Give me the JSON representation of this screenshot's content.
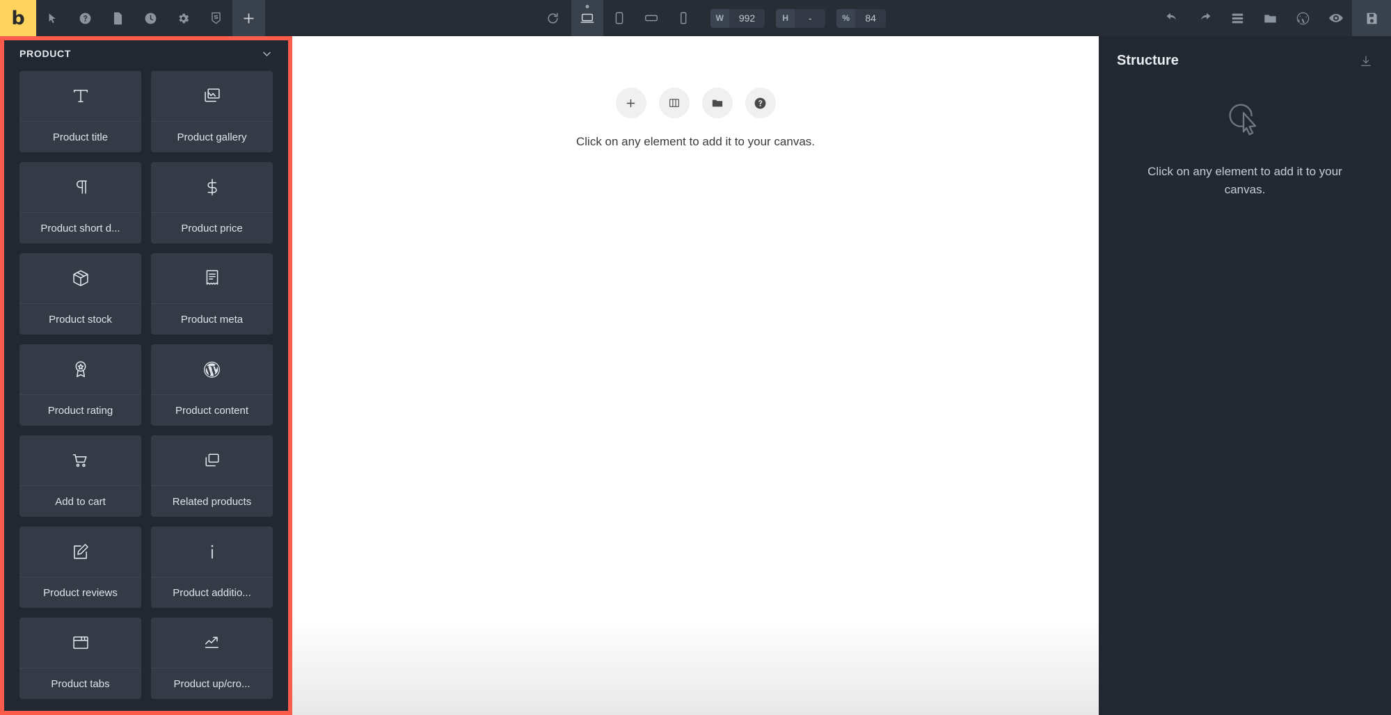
{
  "toolbar": {
    "logo_text": "b",
    "left_icons": [
      {
        "name": "cursor-icon",
        "label": "Select"
      },
      {
        "name": "help-icon",
        "label": "Help"
      },
      {
        "name": "page-icon",
        "label": "Pages"
      },
      {
        "name": "history-icon",
        "label": "History"
      },
      {
        "name": "gear-icon",
        "label": "Settings"
      },
      {
        "name": "css-icon",
        "label": "CSS"
      }
    ],
    "add_label": "+",
    "reload_label": "Reload",
    "devices": [
      {
        "name": "desktop-icon",
        "label": "Desktop",
        "active": true
      },
      {
        "name": "tablet-portrait-icon",
        "label": "Tablet",
        "active": false
      },
      {
        "name": "tablet-landscape-icon",
        "label": "Tablet landscape",
        "active": false
      },
      {
        "name": "mobile-icon",
        "label": "Mobile",
        "active": false
      }
    ],
    "fields": [
      {
        "label": "W",
        "value": "992"
      },
      {
        "label": "H",
        "value": "-"
      },
      {
        "label": "%",
        "value": "84"
      }
    ],
    "right_icons": [
      {
        "name": "undo-icon",
        "label": "Undo"
      },
      {
        "name": "redo-icon",
        "label": "Redo"
      },
      {
        "name": "layers-icon",
        "label": "Layers"
      },
      {
        "name": "folder-icon",
        "label": "Folder"
      },
      {
        "name": "wordpress-icon",
        "label": "WordPress"
      },
      {
        "name": "eye-icon",
        "label": "Preview"
      }
    ],
    "save_label": "Save"
  },
  "sidebar": {
    "panel_title": "PRODUCT",
    "collapse_icon": "chevron-down-icon",
    "highlight_color": "#fb5c4c",
    "tiles": [
      {
        "label": "Product title",
        "icon": "text-title-icon"
      },
      {
        "label": "Product gallery",
        "icon": "image-gallery-icon"
      },
      {
        "label": "Product short d...",
        "icon": "paragraph-icon"
      },
      {
        "label": "Product price",
        "icon": "dollar-icon"
      },
      {
        "label": "Product stock",
        "icon": "box-icon"
      },
      {
        "label": "Product meta",
        "icon": "receipt-icon"
      },
      {
        "label": "Product rating",
        "icon": "award-icon"
      },
      {
        "label": "Product content",
        "icon": "wordpress-icon"
      },
      {
        "label": "Add to cart",
        "icon": "cart-icon"
      },
      {
        "label": "Related products",
        "icon": "copy-icon"
      },
      {
        "label": "Product reviews",
        "icon": "edit-note-icon"
      },
      {
        "label": "Product additio...",
        "icon": "info-icon"
      },
      {
        "label": "Product tabs",
        "icon": "folder-tabs-icon"
      },
      {
        "label": "Product up/cro...",
        "icon": "trend-up-icon"
      }
    ]
  },
  "canvas": {
    "buttons": [
      {
        "name": "add-element-button",
        "icon": "plus-icon"
      },
      {
        "name": "add-columns-button",
        "icon": "columns-icon"
      },
      {
        "name": "open-library-button",
        "icon": "folder-icon"
      },
      {
        "name": "help-button",
        "icon": "question-icon"
      }
    ],
    "hint": "Click on any element to add it to your canvas."
  },
  "structure": {
    "title": "Structure",
    "download_icon": "download-icon",
    "empty_icon": "click-cursor-icon",
    "empty_text": "Click on any element to add it to your canvas."
  }
}
